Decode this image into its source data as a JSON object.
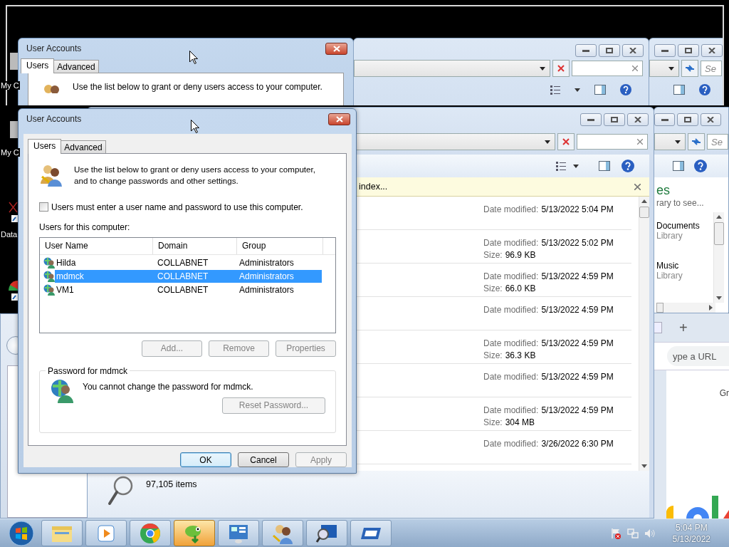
{
  "ghost_screen": {
    "desktop_label": "My C",
    "dialog": {
      "title": "User Accounts",
      "tabs": [
        {
          "label": "Users",
          "selected": true
        },
        {
          "label": "Advanced",
          "selected": false
        }
      ],
      "description": "Use the list below to grant or deny users access to your computer."
    },
    "right_window": {
      "search_text": "Se"
    }
  },
  "desktop_icons": [
    {
      "label": "My C"
    },
    {
      "label": "Data"
    }
  ],
  "explorer": {
    "infobar_text": "index...",
    "files": [
      {
        "date_label": "Date modified:",
        "date": "5/13/2022 5:04 PM"
      },
      {
        "date_label": "Date modified:",
        "date": "5/13/2022 5:02 PM",
        "size_label": "Size:",
        "size": "96.9 KB"
      },
      {
        "date_label": "Date modified:",
        "date": "5/13/2022 4:59 PM",
        "size_label": "Size:",
        "size": "66.0 KB"
      },
      {
        "date_label": "Date modified:",
        "date": "5/13/2022 4:59 PM"
      },
      {
        "date_label": "Date modified:",
        "date": "5/13/2022 4:59 PM",
        "size_label": "Size:",
        "size": "36.3 KB"
      },
      {
        "date_label": "Date modified:",
        "date": "5/13/2022 4:59 PM"
      },
      {
        "date_label": "Date modified:",
        "date": "5/13/2022 4:59 PM",
        "size_label": "Size:",
        "size": "304 MB"
      },
      {
        "date_label": "Date modified:",
        "date": "3/26/2022 6:30 PM"
      }
    ],
    "item_count": "97,105 items"
  },
  "libraries_window": {
    "search_text": "Se",
    "heading": "es",
    "subtitle": "rary to see...",
    "libraries": [
      {
        "name": "Documents",
        "type": "Library"
      },
      {
        "name": "Music",
        "type": "Library"
      }
    ]
  },
  "browser_window": {
    "new_tab": "+",
    "address_placeholder": "ype a URL",
    "page_text": "Gr"
  },
  "dialog": {
    "title": "User Accounts",
    "tabs": [
      {
        "label": "Users",
        "selected": true
      },
      {
        "label": "Advanced",
        "selected": false
      }
    ],
    "description": "Use the list below to grant or deny users access to your computer, and to change passwords and other settings.",
    "require_login": {
      "label": "Users must enter a user name and password to use this computer.",
      "checked": false
    },
    "list_label": "Users for this computer:",
    "columns": [
      "User Name",
      "Domain",
      "Group"
    ],
    "users": [
      {
        "name": "Hilda",
        "domain": "COLLABNET",
        "group": "Administrators",
        "selected": false
      },
      {
        "name": "mdmck",
        "domain": "COLLABNET",
        "group": "Administrators",
        "selected": true
      },
      {
        "name": "VM1",
        "domain": "COLLABNET",
        "group": "Administrators",
        "selected": false
      }
    ],
    "buttons": [
      {
        "label": "Add...",
        "disabled": true
      },
      {
        "label": "Remove",
        "disabled": true
      },
      {
        "label": "Properties",
        "disabled": true
      }
    ],
    "password_group": {
      "title": "Password for mdmck",
      "message": "You cannot change the password for mdmck.",
      "button": {
        "label": "Reset Password...",
        "disabled": true
      }
    },
    "footer_buttons": [
      {
        "label": "OK",
        "default": true,
        "disabled": false
      },
      {
        "label": "Cancel",
        "default": false,
        "disabled": false
      },
      {
        "label": "Apply",
        "default": false,
        "disabled": true
      }
    ]
  },
  "taskbar": {
    "apps": [
      {
        "kind": "explorer",
        "highlighted": false
      },
      {
        "kind": "media",
        "highlighted": false
      },
      {
        "kind": "chrome",
        "highlighted": false
      },
      {
        "kind": "chameleon",
        "highlighted": true
      },
      {
        "kind": "control",
        "highlighted": false
      },
      {
        "kind": "users",
        "highlighted": false
      },
      {
        "kind": "search",
        "highlighted": false
      },
      {
        "kind": "display",
        "highlighted": false
      }
    ],
    "time": "5:04 PM",
    "date": "5/13/2022"
  }
}
